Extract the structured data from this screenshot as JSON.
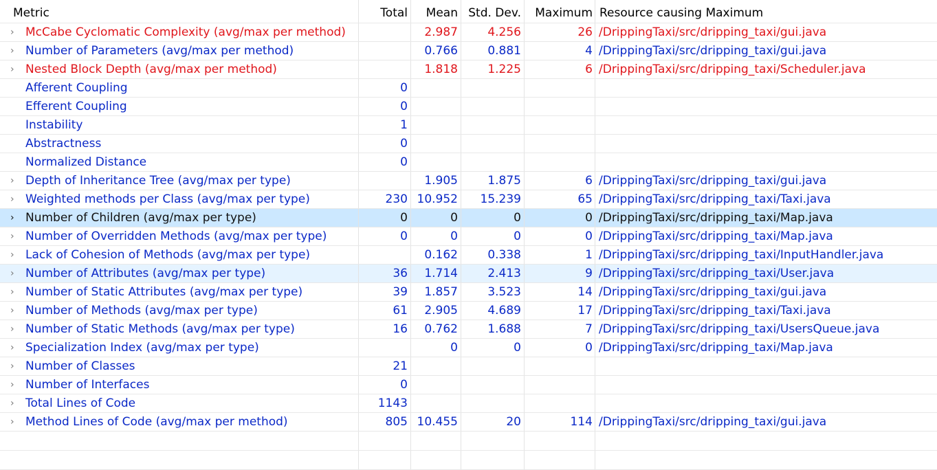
{
  "columns": {
    "metric": "Metric",
    "total": "Total",
    "mean": "Mean",
    "std": "Std. Dev.",
    "max": "Maximum",
    "resource": "Resource causing Maximum"
  },
  "rows": [
    {
      "metric": "McCabe Cyclomatic Complexity (avg/max per method)",
      "total": "",
      "mean": "2.987",
      "std": "4.256",
      "max": "26",
      "resource": "/DrippingTaxi/src/dripping_taxi/gui.java",
      "color": "red",
      "expandable": true
    },
    {
      "metric": "Number of Parameters (avg/max per method)",
      "total": "",
      "mean": "0.766",
      "std": "0.881",
      "max": "4",
      "resource": "/DrippingTaxi/src/dripping_taxi/gui.java",
      "color": "blue",
      "expandable": true
    },
    {
      "metric": "Nested Block Depth (avg/max per method)",
      "total": "",
      "mean": "1.818",
      "std": "1.225",
      "max": "6",
      "resource": "/DrippingTaxi/src/dripping_taxi/Scheduler.java",
      "color": "red",
      "expandable": true
    },
    {
      "metric": "Afferent Coupling",
      "total": "0",
      "mean": "",
      "std": "",
      "max": "",
      "resource": "",
      "color": "blue",
      "expandable": false
    },
    {
      "metric": "Efferent Coupling",
      "total": "0",
      "mean": "",
      "std": "",
      "max": "",
      "resource": "",
      "color": "blue",
      "expandable": false
    },
    {
      "metric": "Instability",
      "total": "1",
      "mean": "",
      "std": "",
      "max": "",
      "resource": "",
      "color": "blue",
      "expandable": false
    },
    {
      "metric": "Abstractness",
      "total": "0",
      "mean": "",
      "std": "",
      "max": "",
      "resource": "",
      "color": "blue",
      "expandable": false
    },
    {
      "metric": "Normalized Distance",
      "total": "0",
      "mean": "",
      "std": "",
      "max": "",
      "resource": "",
      "color": "blue",
      "expandable": false
    },
    {
      "metric": "Depth of Inheritance Tree (avg/max per type)",
      "total": "",
      "mean": "1.905",
      "std": "1.875",
      "max": "6",
      "resource": "/DrippingTaxi/src/dripping_taxi/gui.java",
      "color": "blue",
      "expandable": true
    },
    {
      "metric": "Weighted methods per Class (avg/max per type)",
      "total": "230",
      "mean": "10.952",
      "std": "15.239",
      "max": "65",
      "resource": "/DrippingTaxi/src/dripping_taxi/Taxi.java",
      "color": "blue",
      "expandable": true
    },
    {
      "metric": "Number of Children (avg/max per type)",
      "total": "0",
      "mean": "0",
      "std": "0",
      "max": "0",
      "resource": "/DrippingTaxi/src/dripping_taxi/Map.java",
      "color": "blue",
      "expandable": true,
      "state": "sel"
    },
    {
      "metric": "Number of Overridden Methods (avg/max per type)",
      "total": "0",
      "mean": "0",
      "std": "0",
      "max": "0",
      "resource": "/DrippingTaxi/src/dripping_taxi/Map.java",
      "color": "blue",
      "expandable": true
    },
    {
      "metric": "Lack of Cohesion of Methods (avg/max per type)",
      "total": "",
      "mean": "0.162",
      "std": "0.338",
      "max": "1",
      "resource": "/DrippingTaxi/src/dripping_taxi/InputHandler.java",
      "color": "blue",
      "expandable": true
    },
    {
      "metric": "Number of Attributes (avg/max per type)",
      "total": "36",
      "mean": "1.714",
      "std": "2.413",
      "max": "9",
      "resource": "/DrippingTaxi/src/dripping_taxi/User.java",
      "color": "blue",
      "expandable": true,
      "state": "hover"
    },
    {
      "metric": "Number of Static Attributes (avg/max per type)",
      "total": "39",
      "mean": "1.857",
      "std": "3.523",
      "max": "14",
      "resource": "/DrippingTaxi/src/dripping_taxi/gui.java",
      "color": "blue",
      "expandable": true
    },
    {
      "metric": "Number of Methods (avg/max per type)",
      "total": "61",
      "mean": "2.905",
      "std": "4.689",
      "max": "17",
      "resource": "/DrippingTaxi/src/dripping_taxi/Taxi.java",
      "color": "blue",
      "expandable": true
    },
    {
      "metric": "Number of Static Methods (avg/max per type)",
      "total": "16",
      "mean": "0.762",
      "std": "1.688",
      "max": "7",
      "resource": "/DrippingTaxi/src/dripping_taxi/UsersQueue.java",
      "color": "blue",
      "expandable": true
    },
    {
      "metric": "Specialization Index (avg/max per type)",
      "total": "",
      "mean": "0",
      "std": "0",
      "max": "0",
      "resource": "/DrippingTaxi/src/dripping_taxi/Map.java",
      "color": "blue",
      "expandable": true
    },
    {
      "metric": "Number of Classes",
      "total": "21",
      "mean": "",
      "std": "",
      "max": "",
      "resource": "",
      "color": "blue",
      "expandable": true
    },
    {
      "metric": "Number of Interfaces",
      "total": "0",
      "mean": "",
      "std": "",
      "max": "",
      "resource": "",
      "color": "blue",
      "expandable": true
    },
    {
      "metric": "Total Lines of Code",
      "total": "1143",
      "mean": "",
      "std": "",
      "max": "",
      "resource": "",
      "color": "blue",
      "expandable": true
    },
    {
      "metric": "Method Lines of Code (avg/max per method)",
      "total": "805",
      "mean": "10.455",
      "std": "20",
      "max": "114",
      "resource": "/DrippingTaxi/src/dripping_taxi/gui.java",
      "color": "blue",
      "expandable": true
    }
  ],
  "icons": {
    "expand": "chevron-right-icon"
  },
  "colors": {
    "blue": "#0b29c7",
    "red": "#e0161c",
    "selected": "#cce8ff",
    "hover": "#e5f3ff"
  }
}
